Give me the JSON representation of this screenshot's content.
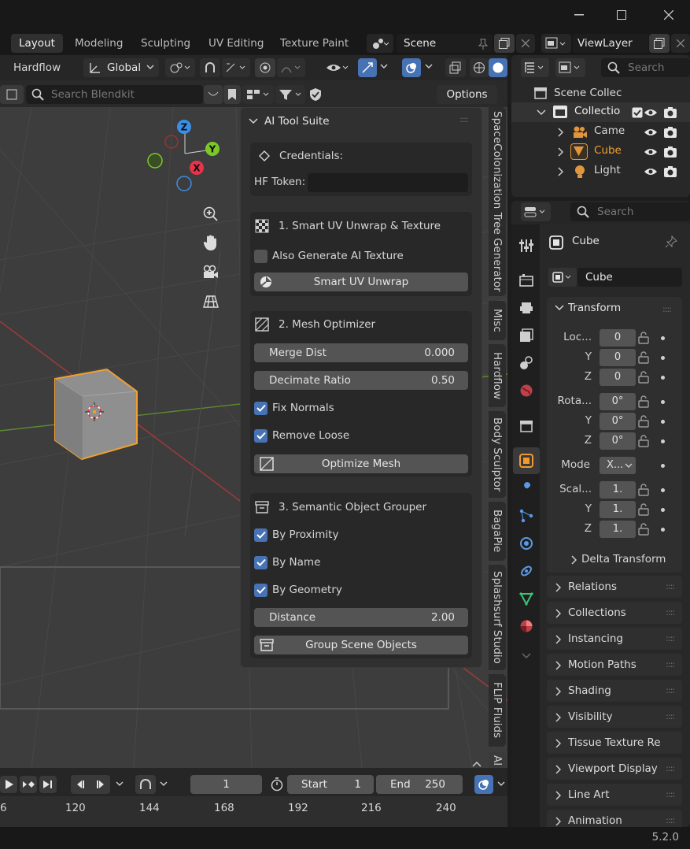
{
  "workspace_tabs": [
    "Layout",
    "Modeling",
    "Sculpting",
    "UV Editing",
    "Texture Paint"
  ],
  "scene_name": "Scene",
  "view_layer": "ViewLayer",
  "viewport_header": {
    "addon": "Hardflow",
    "orientation": "Global"
  },
  "blendkit": {
    "search_placeholder": "Search Blendkit",
    "options_label": "Options"
  },
  "gizmo_axes": {
    "z": "Z",
    "y": "Y",
    "x": "X"
  },
  "ai_panel": {
    "title": "AI Tool Suite",
    "credentials": {
      "title": "Credentials:",
      "hf_token_label": "HF Token:",
      "hf_token_value": ""
    },
    "uv": {
      "title": "1. Smart UV Unwrap & Texture",
      "also_generate_label": "Also Generate AI Texture",
      "also_generate": false,
      "button": "Smart UV Unwrap"
    },
    "mesh": {
      "title": "2. Mesh Optimizer",
      "merge_label": "Merge Dist",
      "merge_value": "0.000",
      "decimate_label": "Decimate Ratio",
      "decimate_value": "0.50",
      "fix_normals": "Fix Normals",
      "remove_loose": "Remove Loose",
      "button": "Optimize Mesh"
    },
    "grouper": {
      "title": "3. Semantic Object Grouper",
      "by_proximity": "By Proximity",
      "by_name": "By Name",
      "by_geometry": "By Geometry",
      "distance_label": "Distance",
      "distance_value": "2.00",
      "button": "Group Scene Objects"
    }
  },
  "side_tabs": [
    "SpaceColonization Tree Generator",
    "Misc",
    "Hardflow",
    "Body Sculptor",
    "BagaPie",
    "Splashsurf Studio",
    "FLIP Fluids",
    "AI"
  ],
  "timeline": {
    "current_frame": "1",
    "start_label": "Start",
    "start": "1",
    "end_label": "End",
    "end": "250",
    "ruler": [
      "6",
      "120",
      "144",
      "168",
      "192",
      "216",
      "240"
    ]
  },
  "outliner": {
    "search_placeholder": "Search",
    "scene_collection": "Scene Collec",
    "collection": "Collectio",
    "items": [
      "Came",
      "Cube",
      "Light"
    ]
  },
  "properties": {
    "search_placeholder": "Search",
    "object_name": "Cube",
    "object_field": "Cube",
    "transform_title": "Transform",
    "location_label": "Loc...",
    "location": [
      "0",
      "0",
      "0"
    ],
    "rotation_label": "Rota...",
    "rotation": [
      "0°",
      "0°",
      "0°"
    ],
    "mode_label": "Mode",
    "mode_value": "X...",
    "scale_label": "Scal...",
    "scale": [
      "1.",
      "1.",
      "1."
    ],
    "axis_y": "Y",
    "axis_z": "Z",
    "delta_transform": "Delta Transform",
    "sections": [
      "Relations",
      "Collections",
      "Instancing",
      "Motion Paths",
      "Shading",
      "Visibility",
      "Tissue Texture Re",
      "Viewport Display",
      "Line Art",
      "Animation"
    ]
  },
  "version": "5.2.0",
  "colors": {
    "accent": "#4772b3",
    "selected_orange": "#f0a030",
    "axis_x": "#e8344a",
    "axis_y": "#7cc82a",
    "axis_z": "#3a8ee6"
  }
}
